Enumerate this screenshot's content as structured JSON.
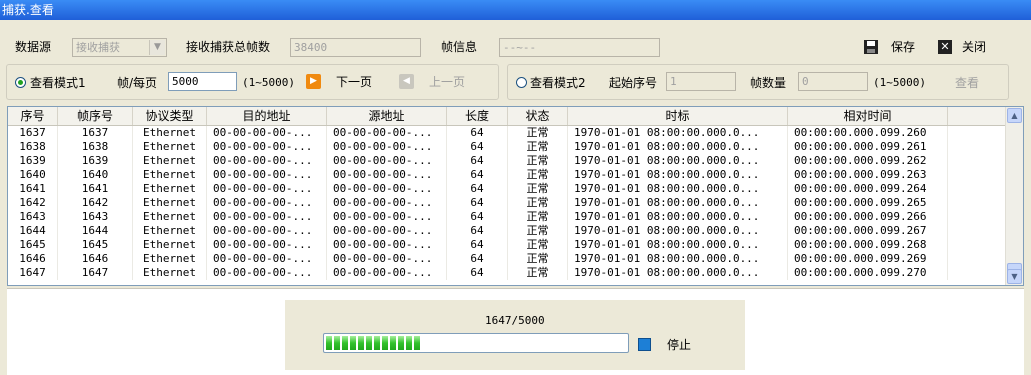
{
  "window": {
    "title": "捕获.查看"
  },
  "toolbar": {
    "datasource_label": "数据源",
    "datasource_value": "接收捕获",
    "total_frames_label": "接收捕获总帧数",
    "total_frames_value": "38400",
    "frame_info_label": "帧信息",
    "frame_info_value": "--~--",
    "save_label": "保存",
    "close_label": "关闭"
  },
  "mode1": {
    "radio_label": "查看模式1",
    "per_page_label": "帧/每页",
    "per_page_value": "5000",
    "range_hint": "(1~5000)",
    "next_label": "下一页",
    "prev_label": "上一页",
    "selected": true
  },
  "mode2": {
    "radio_label": "查看模式2",
    "start_label": "起始序号",
    "start_value": "1",
    "count_label": "帧数量",
    "count_value": "0",
    "range_hint": "(1~5000)",
    "view_label": "查看",
    "selected": false
  },
  "table": {
    "columns": [
      "序号",
      "帧序号",
      "协议类型",
      "目的地址",
      "源地址",
      "长度",
      "状态",
      "时标",
      "相对时间"
    ],
    "rows": [
      [
        "1637",
        "1637",
        "Ethernet",
        "00-00-00-00-...",
        "00-00-00-00-...",
        "64",
        "正常",
        "1970-01-01  08:00:00.000.0...",
        "00:00:00.000.099.260"
      ],
      [
        "1638",
        "1638",
        "Ethernet",
        "00-00-00-00-...",
        "00-00-00-00-...",
        "64",
        "正常",
        "1970-01-01  08:00:00.000.0...",
        "00:00:00.000.099.261"
      ],
      [
        "1639",
        "1639",
        "Ethernet",
        "00-00-00-00-...",
        "00-00-00-00-...",
        "64",
        "正常",
        "1970-01-01  08:00:00.000.0...",
        "00:00:00.000.099.262"
      ],
      [
        "1640",
        "1640",
        "Ethernet",
        "00-00-00-00-...",
        "00-00-00-00-...",
        "64",
        "正常",
        "1970-01-01  08:00:00.000.0...",
        "00:00:00.000.099.263"
      ],
      [
        "1641",
        "1641",
        "Ethernet",
        "00-00-00-00-...",
        "00-00-00-00-...",
        "64",
        "正常",
        "1970-01-01  08:00:00.000.0...",
        "00:00:00.000.099.264"
      ],
      [
        "1642",
        "1642",
        "Ethernet",
        "00-00-00-00-...",
        "00-00-00-00-...",
        "64",
        "正常",
        "1970-01-01  08:00:00.000.0...",
        "00:00:00.000.099.265"
      ],
      [
        "1643",
        "1643",
        "Ethernet",
        "00-00-00-00-...",
        "00-00-00-00-...",
        "64",
        "正常",
        "1970-01-01  08:00:00.000.0...",
        "00:00:00.000.099.266"
      ],
      [
        "1644",
        "1644",
        "Ethernet",
        "00-00-00-00-...",
        "00-00-00-00-...",
        "64",
        "正常",
        "1970-01-01  08:00:00.000.0...",
        "00:00:00.000.099.267"
      ],
      [
        "1645",
        "1645",
        "Ethernet",
        "00-00-00-00-...",
        "00-00-00-00-...",
        "64",
        "正常",
        "1970-01-01  08:00:00.000.0...",
        "00:00:00.000.099.268"
      ],
      [
        "1646",
        "1646",
        "Ethernet",
        "00-00-00-00-...",
        "00-00-00-00-...",
        "64",
        "正常",
        "1970-01-01  08:00:00.000.0...",
        "00:00:00.000.099.269"
      ],
      [
        "1647",
        "1647",
        "Ethernet",
        "00-00-00-00-...",
        "00-00-00-00-...",
        "64",
        "正常",
        "1970-01-01  08:00:00.000.0...",
        "00:00:00.000.099.270"
      ]
    ]
  },
  "progress": {
    "text": "1647/5000",
    "current": 1647,
    "total": 5000,
    "stop_label": "停止"
  },
  "colors": {
    "titlebar": "#2a74e8",
    "progress_green": "#33c22c",
    "stop_icon": "#1d7fd6",
    "next_icon": "#f08a10"
  },
  "icons": {
    "save": "floppy-disk-icon",
    "close": "x-icon",
    "next": "next-page-icon",
    "prev": "prev-page-icon",
    "stop": "stop-square-icon"
  }
}
